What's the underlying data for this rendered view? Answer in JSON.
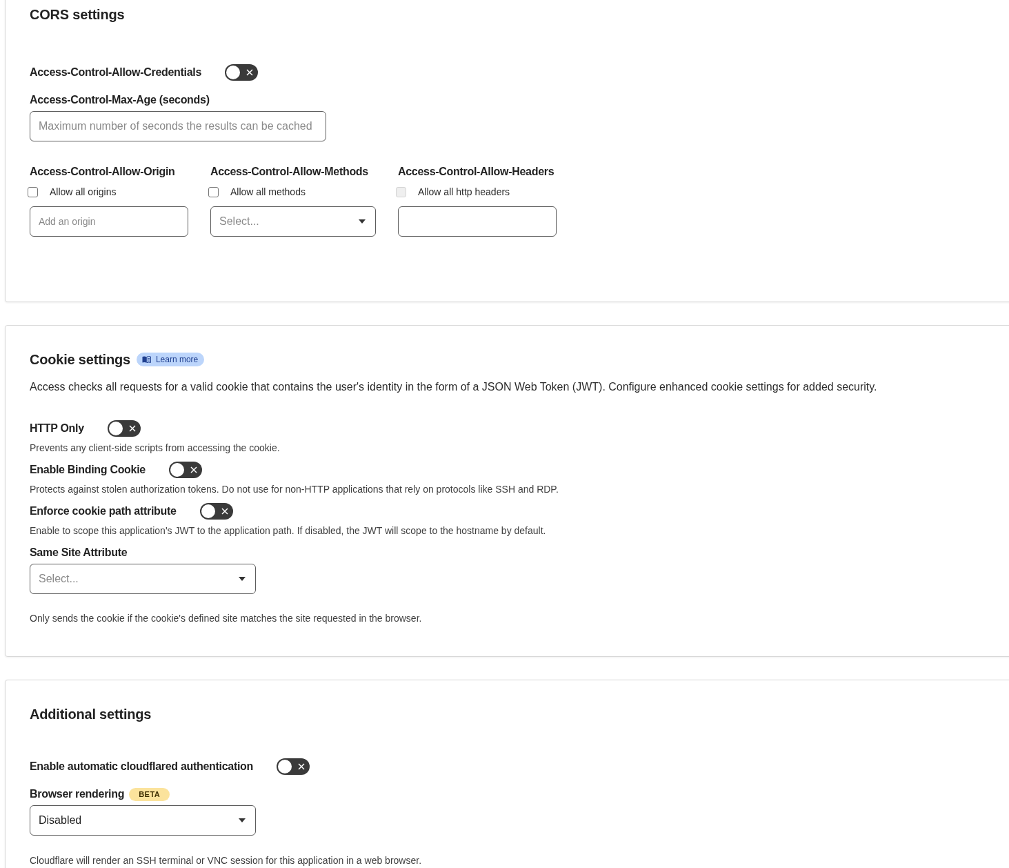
{
  "cors": {
    "title": "CORS settings",
    "credentials": {
      "label": "Access-Control-Allow-Credentials",
      "on": false
    },
    "max_age": {
      "label": "Access-Control-Max-Age (seconds)",
      "placeholder": "Maximum number of seconds the results can be cached"
    },
    "columns": [
      {
        "heading": "Access-Control-Allow-Origin",
        "checkbox": {
          "label": "Allow all origins",
          "checked": false,
          "disabled": false
        },
        "field": {
          "kind": "input",
          "placeholder": "Add an origin"
        }
      },
      {
        "heading": "Access-Control-Allow-Methods",
        "checkbox": {
          "label": "Allow all methods",
          "checked": false,
          "disabled": false
        },
        "field": {
          "kind": "select",
          "placeholder": "Select..."
        }
      },
      {
        "heading": "Access-Control-Allow-Headers",
        "checkbox": {
          "label": "Allow all http headers",
          "checked": false,
          "disabled": true
        },
        "field": {
          "kind": "input"
        }
      }
    ]
  },
  "cookie": {
    "title": "Cookie settings",
    "learn_more": "Learn more",
    "description": "Access checks all requests for a valid cookie that contains the user's identity in the form of a JSON Web Token (JWT). Configure enhanced cookie settings for added security.",
    "toggles": [
      {
        "label": "HTTP Only",
        "on": false,
        "hint": "Prevents any client-side scripts from accessing the cookie."
      },
      {
        "label": "Enable Binding Cookie",
        "on": false,
        "hint": "Protects against stolen authorization tokens. Do not use for non-HTTP applications that rely on protocols like SSH and RDP."
      },
      {
        "label": "Enforce cookie path attribute",
        "on": false,
        "hint": "Enable to scope this application's JWT to the application path. If disabled, the JWT will scope to the hostname by default."
      }
    ],
    "same_site": {
      "label": "Same Site Attribute",
      "placeholder": "Select...",
      "hint": "Only sends the cookie if the cookie's defined site matches the site requested in the browser."
    }
  },
  "additional": {
    "title": "Additional settings",
    "toggles": [
      {
        "label": "Enable automatic cloudflared authentication",
        "on": false
      }
    ],
    "browser_rendering": {
      "label": "Browser rendering",
      "badge": "BETA",
      "value": "Disabled",
      "hint": "Cloudflare will render an SSH terminal or VNC session for this application in a web browser."
    }
  }
}
